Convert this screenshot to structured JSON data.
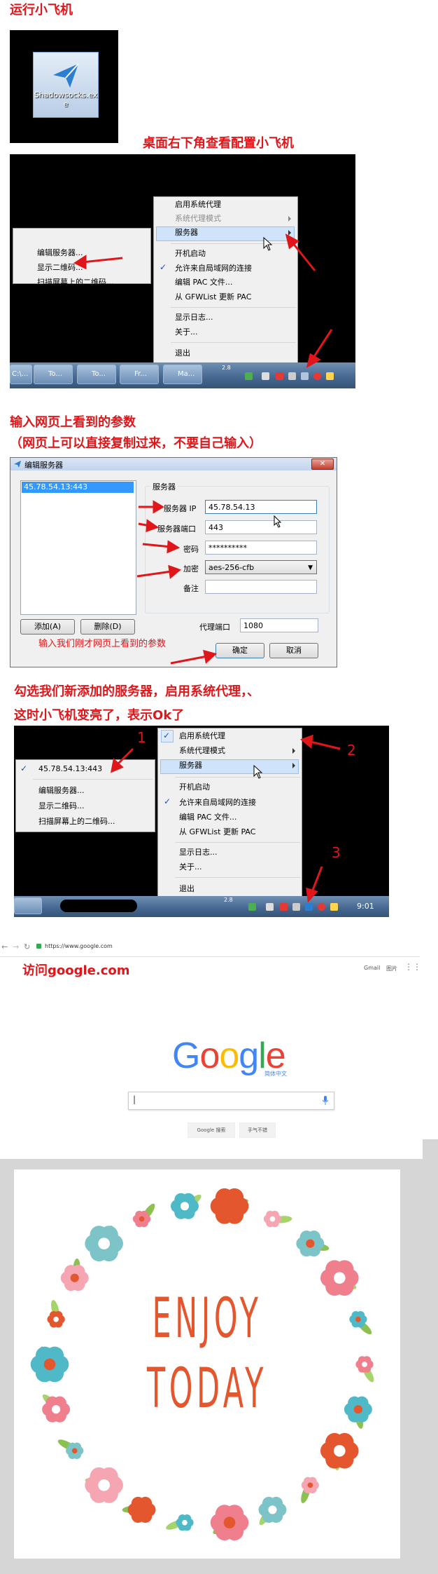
{
  "step1": {
    "heading": "运行小飞机",
    "icon_label": "Shadowsocks.exe"
  },
  "step2": {
    "heading": "桌面右下角查看配置小飞机",
    "menu": [
      "启用系统代理",
      "系统代理模式",
      "服务器",
      "开机启动",
      "允许来自局域网的连接",
      "编辑 PAC 文件...",
      "从 GFWList 更新 PAC",
      "显示日志...",
      "关于...",
      "退出"
    ],
    "submenu": [
      "编辑服务器...",
      "显示二维码...",
      "扫描屏幕上的二维码..."
    ],
    "taskbar": [
      "C:\\...",
      "To...",
      "To...",
      "Fr...",
      "Ma..."
    ],
    "tray_text": "2.8"
  },
  "step3": {
    "heading_line1": "输入网页上看到的参数",
    "heading_line2": "（网页上可以直接复制过来，不要自己输入）",
    "dialog_title": "编辑服务器",
    "server_list_item": "45.78.54.13:443",
    "group_title": "服务器",
    "fields": {
      "ip_label": "服务器 IP",
      "ip_value": "45.78.54.13",
      "port_label": "服务器端口",
      "port_value": "443",
      "password_label": "密码",
      "password_value": "**********",
      "encryption_label": "加密",
      "encryption_value": "aes-256-cfb",
      "remarks_label": "备注",
      "remarks_value": "",
      "proxy_port_label": "代理端口",
      "proxy_port_value": "1080"
    },
    "add_button": "添加(A)",
    "delete_button": "删除(D)",
    "ok_button": "确定",
    "cancel_button": "取消",
    "annotation": "输入我们刚才网页上看到的参数"
  },
  "step4": {
    "heading_line1": "勾选我们新添加的服务器，启用系统代理，、",
    "heading_line2": "这时小飞机变亮了，表示Ok了",
    "server_item": "45.78.54.13:443",
    "submenu": [
      "编辑服务器...",
      "显示二维码...",
      "扫描屏幕上的二维码..."
    ],
    "menu": [
      "启用系统代理",
      "系统代理模式",
      "服务器",
      "开机启动",
      "允许来自局域网的连接",
      "编辑 PAC 文件...",
      "从 GFWList 更新 PAC",
      "显示日志...",
      "关于...",
      "退出"
    ],
    "markers": [
      "1",
      "2",
      "3"
    ],
    "clock": "9:01",
    "tray_text": "2.8"
  },
  "step5": {
    "url": "https://www.google.com",
    "heading": "访问google.com",
    "top_links": [
      "Gmail",
      "图片"
    ],
    "logo_letters": [
      "G",
      "o",
      "o",
      "g",
      "l",
      "e"
    ],
    "logo_colors": [
      "#4285f4",
      "#ea4335",
      "#fbbc05",
      "#4285f4",
      "#34a853",
      "#ea4335"
    ],
    "logo_suffix": "简体中文",
    "search_button": "Google 搜索",
    "lucky_button": "手气不错"
  },
  "poster": {
    "line1": "ENJOY",
    "line2": "TODAY"
  },
  "colors": {
    "red": "#e0161a",
    "check": "#1a4fb5",
    "highlight": "#cfe3fb"
  }
}
